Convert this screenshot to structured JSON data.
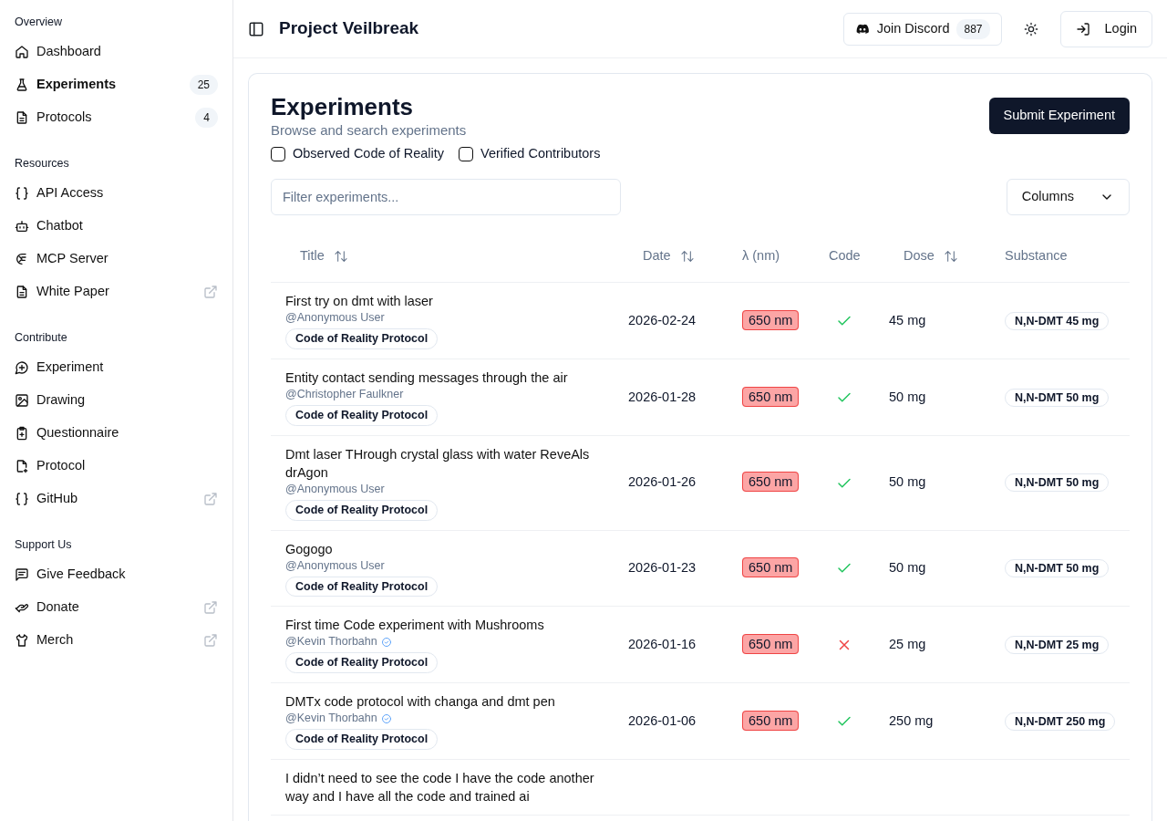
{
  "sidebar": {
    "sections": [
      {
        "heading": "Overview",
        "items": [
          {
            "label": "Dashboard",
            "selected": false
          },
          {
            "label": "Experiments",
            "selected": true,
            "count": "25"
          },
          {
            "label": "Protocols",
            "selected": false,
            "count": "4"
          }
        ]
      },
      {
        "heading": "Resources",
        "items": [
          {
            "label": "API Access",
            "selected": false
          },
          {
            "label": "Chatbot",
            "selected": false
          },
          {
            "label": "MCP Server",
            "selected": false
          },
          {
            "label": "White Paper",
            "selected": false,
            "external": true
          }
        ]
      },
      {
        "heading": "Contribute",
        "items": [
          {
            "label": "Experiment",
            "selected": false
          },
          {
            "label": "Drawing",
            "selected": false
          },
          {
            "label": "Questionnaire",
            "selected": false
          },
          {
            "label": "Protocol",
            "selected": false
          },
          {
            "label": "GitHub",
            "selected": false,
            "external": true
          }
        ]
      },
      {
        "heading": "Support Us",
        "items": [
          {
            "label": "Give Feedback",
            "selected": false
          },
          {
            "label": "Donate",
            "selected": false,
            "external": true
          },
          {
            "label": "Merch",
            "selected": false,
            "external": true
          }
        ]
      }
    ]
  },
  "header": {
    "title": "Project Veilbreak",
    "discord": {
      "label": "Join Discord",
      "count": "887"
    },
    "login": "Login"
  },
  "page": {
    "title": "Experiments",
    "subtitle": "Browse and search experiments",
    "submit": "Submit Experiment",
    "filters": [
      {
        "label": "Observed Code of Reality",
        "checked": false
      },
      {
        "label": "Verified Contributors",
        "checked": false
      }
    ],
    "search": {
      "placeholder": "Filter experiments..."
    },
    "columns_button": "Columns"
  },
  "table": {
    "columns": [
      {
        "label": "Title",
        "sortable": true
      },
      {
        "label": "Date",
        "sortable": true
      },
      {
        "label": "λ (nm)",
        "sortable": false
      },
      {
        "label": "Code",
        "sortable": false
      },
      {
        "label": "Dose",
        "sortable": true
      },
      {
        "label": "Substance",
        "sortable": false
      }
    ],
    "rows": [
      {
        "title": "First try on dmt with laser",
        "author": "@Anonymous User",
        "verified": false,
        "tag": "Code of Reality Protocol",
        "date": "2026-02-24",
        "wavelength": "650 nm",
        "code": true,
        "dose": "45 mg",
        "substance": "N,N-DMT 45 mg"
      },
      {
        "title": "Entity contact sending messages through the air",
        "author": "@Christopher Faulkner",
        "verified": false,
        "tag": "Code of Reality Protocol",
        "date": "2026-01-28",
        "wavelength": "650 nm",
        "code": true,
        "dose": "50 mg",
        "substance": "N,N-DMT 50 mg"
      },
      {
        "title": "Dmt laser THrough crystal glass with water ReveAls drAgon",
        "author": "@Anonymous User",
        "verified": false,
        "tag": "Code of Reality Protocol",
        "date": "2026-01-26",
        "wavelength": "650 nm",
        "code": true,
        "dose": "50 mg",
        "substance": "N,N-DMT 50 mg"
      },
      {
        "title": "Gogogo",
        "author": "@Anonymous User",
        "verified": false,
        "tag": "Code of Reality Protocol",
        "date": "2026-01-23",
        "wavelength": "650 nm",
        "code": true,
        "dose": "50 mg",
        "substance": "N,N-DMT 50 mg"
      },
      {
        "title": "First time Code experiment with Mushrooms",
        "author": "@Kevin Thorbahn",
        "verified": true,
        "tag": "Code of Reality Protocol",
        "date": "2026-01-16",
        "wavelength": "650 nm",
        "code": false,
        "dose": "25 mg",
        "substance": "N,N-DMT 25 mg"
      },
      {
        "title": "DMTx code protocol with changa and dmt pen",
        "author": "@Kevin Thorbahn",
        "verified": true,
        "tag": "Code of Reality Protocol",
        "date": "2026-01-06",
        "wavelength": "650 nm",
        "code": true,
        "dose": "250 mg",
        "substance": "N,N-DMT 250 mg"
      },
      {
        "title": "I didn’t need to see the code I have the code another way and I have all the code and trained ai"
      }
    ]
  }
}
